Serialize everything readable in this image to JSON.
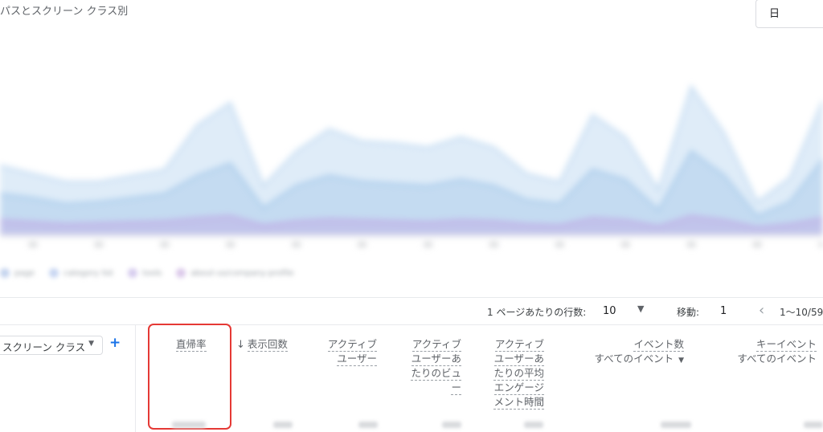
{
  "report": {
    "title": "パスとスクリーン クラス別",
    "period": "日"
  },
  "chart_data": {
    "type": "area",
    "x": [
      0,
      1,
      2,
      3,
      4,
      5,
      6,
      7,
      8,
      9,
      10,
      11,
      12,
      13,
      14,
      15,
      16,
      17,
      18,
      19,
      20,
      21,
      22,
      23,
      24,
      25
    ],
    "series": [
      {
        "values": [
          68,
          60,
          52,
          52,
          58,
          64,
          108,
          130,
          48,
          82,
          104,
          92,
          90,
          86,
          96,
          86,
          60,
          52,
          118,
          96,
          44,
          146,
          100,
          32,
          56,
          132
        ],
        "color": "#c5dcf2"
      },
      {
        "values": [
          40,
          36,
          30,
          32,
          36,
          40,
          58,
          70,
          26,
          48,
          58,
          52,
          50,
          48,
          54,
          48,
          34,
          30,
          64,
          54,
          24,
          82,
          58,
          18,
          32,
          74
        ],
        "color": "#a9cbeb"
      },
      {
        "values": [
          14,
          12,
          10,
          11,
          12,
          13,
          16,
          18,
          9,
          13,
          15,
          14,
          13,
          12,
          14,
          13,
          10,
          9,
          16,
          14,
          8,
          18,
          14,
          7,
          10,
          16
        ],
        "color": "#c0aee6"
      }
    ],
    "ylim": [
      0,
      200
    ]
  },
  "legend": {
    "items": [
      {
        "label": "page",
        "color": "#c5d4ee"
      },
      {
        "label": "category list",
        "color": "#c8d6f2"
      },
      {
        "label": "tools",
        "color": "#d6ccee"
      },
      {
        "label": "about-us/company-profile",
        "color": "#dbc9ea"
      }
    ]
  },
  "pagination": {
    "rows_label": "1 ページあたりの行数:",
    "rows_value": "10",
    "goto_label": "移動:",
    "goto_value": "1",
    "range": "1〜10/59"
  },
  "dimension": {
    "label": "スクリーン クラス"
  },
  "columns": {
    "bounce_rate": "直帰率",
    "views": "表示回数",
    "active_users_l1": "アクティブ",
    "active_users_l2": "ユーザー",
    "views_per_user_l1": "アクティブ",
    "views_per_user_l2": "ユーザーあ",
    "views_per_user_l3": "たりのビュ",
    "views_per_user_l4": "ー",
    "engagement_l1": "アクティブ",
    "engagement_l2": "ユーザーあ",
    "engagement_l3": "たりの平均",
    "engagement_l4": "エンゲージ",
    "engagement_l5": "メント時間",
    "event_count": "イベント数",
    "event_count_sub": "すべてのイベント",
    "key_events": "キーイベント",
    "key_events_sub": "すべてのイベント"
  }
}
